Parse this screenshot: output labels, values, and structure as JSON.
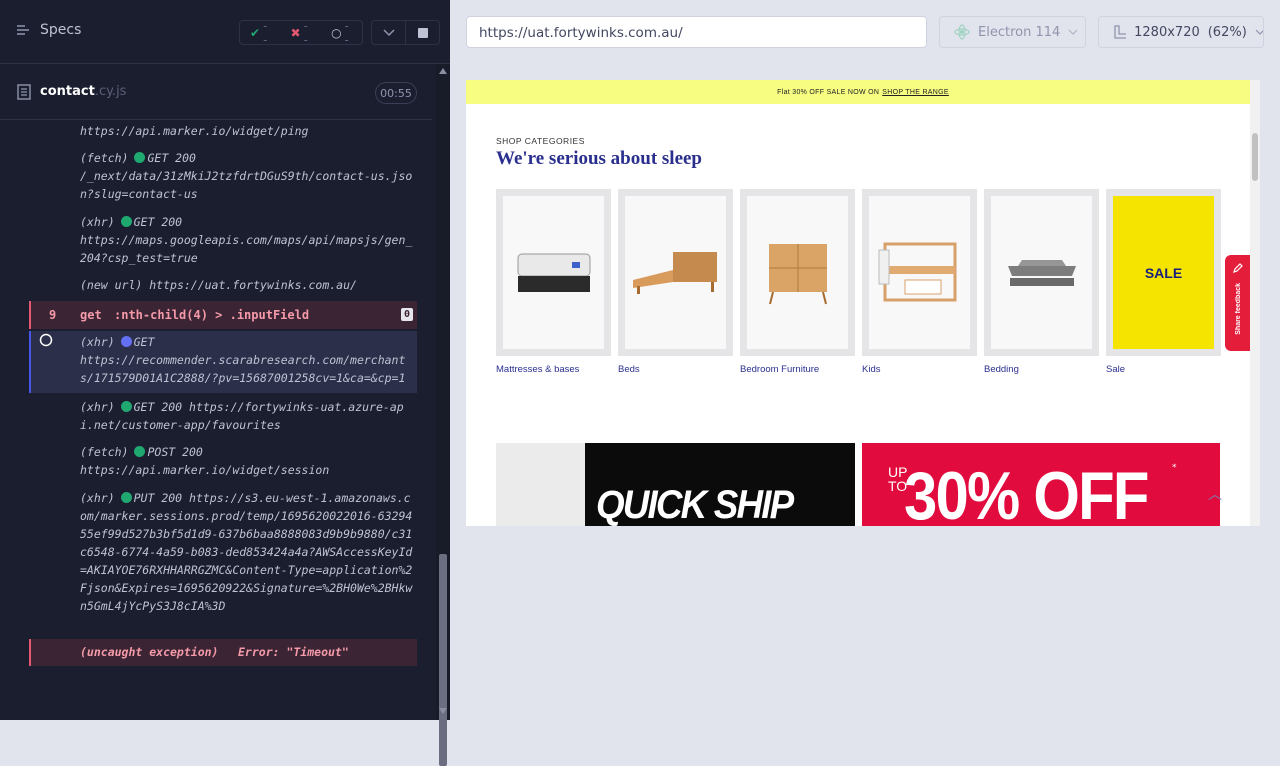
{
  "sidebar": {
    "specs_label": "Specs",
    "stats": {
      "passed": "--",
      "failed": "--",
      "pending": "--"
    },
    "file": {
      "name": "contact",
      "ext": ".cy.js",
      "timer": "00:55"
    }
  },
  "log": {
    "l1_text": "https://api.marker.io/widget/ping",
    "l2_type": "(fetch)",
    "l2_method": "GET 200",
    "l2_url": "/_next/data/31zMkiJ2tzfdrtDGuS9th/contact-us.json?slug=contact-us",
    "l3_type": "(xhr)",
    "l3_method": "GET 200",
    "l3_url": "https://maps.googleapis.com/maps/api/mapsjs/gen_204?csp_test=true",
    "l4_type": "(new url)",
    "l4_url": "https://uat.fortywinks.com.au/",
    "cmd9_num": "9",
    "cmd9_name": "get",
    "cmd9_selector": ":nth-child(4) > .inputField",
    "cmd9_badge": "0",
    "l5_type": "(xhr)",
    "l5_method": "GET",
    "l5_url": "https://recommender.scarabresearch.com/merchants/171579D01A1C2888/?pv=15687001258cv=1&ca=&cp=1",
    "l6_type": "(xhr)",
    "l6_method": "GET 200",
    "l6_url": "https://fortywinks-uat.azure-api.net/customer-app/favourites",
    "l7_type": "(fetch)",
    "l7_method": "POST 200",
    "l7_url": "https://api.marker.io/widget/session",
    "l8_type": "(xhr)",
    "l8_method": "PUT 200",
    "l8_url": "https://s3.eu-west-1.amazonaws.com/marker.sessions.prod/temp/1695620022016-6329455ef99d527b3bf5d1d9-637b6baa8888083d9b9b9880/c31c6548-6774-4a59-b083-ded853424a4a?AWSAccessKeyId=AKIAYOE76RXHHARRGZMC&Content-Type=application%2Fjson&Expires=1695620922&Signature=%2BH0We%2BHkwn5GmL4jYcPyS3J8cIA%3D",
    "exc_type": "(uncaught exception)",
    "exc_msg": "Error: \"Timeout\""
  },
  "browser": {
    "url": "https://uat.fortywinks.com.au/",
    "engine": "Electron 114",
    "viewport": "1280x720",
    "zoom": "(62%)"
  },
  "site": {
    "promo_text": "Flat 30% OFF SALE NOW ON",
    "promo_link": "SHOP THE RANGE",
    "section_label": "SHOP CATEGORIES",
    "section_title": "We're serious about sleep",
    "categories": [
      "Mattresses & bases",
      "Beds",
      "Bedroom Furniture",
      "Kids",
      "Bedding",
      "Sale"
    ],
    "sale_tile": "SALE",
    "banner1": "QUICK SHIP",
    "banner2_up": "UP",
    "banner2_to": "TO",
    "banner2_pct": "30% OFF",
    "banner2_star": "*",
    "feedback": "Share feedback"
  },
  "colors": {
    "accent": "#2a2f8e",
    "promo": "#f6fd80",
    "sale": "#f4e400",
    "banner_red": "#e10b3e"
  }
}
